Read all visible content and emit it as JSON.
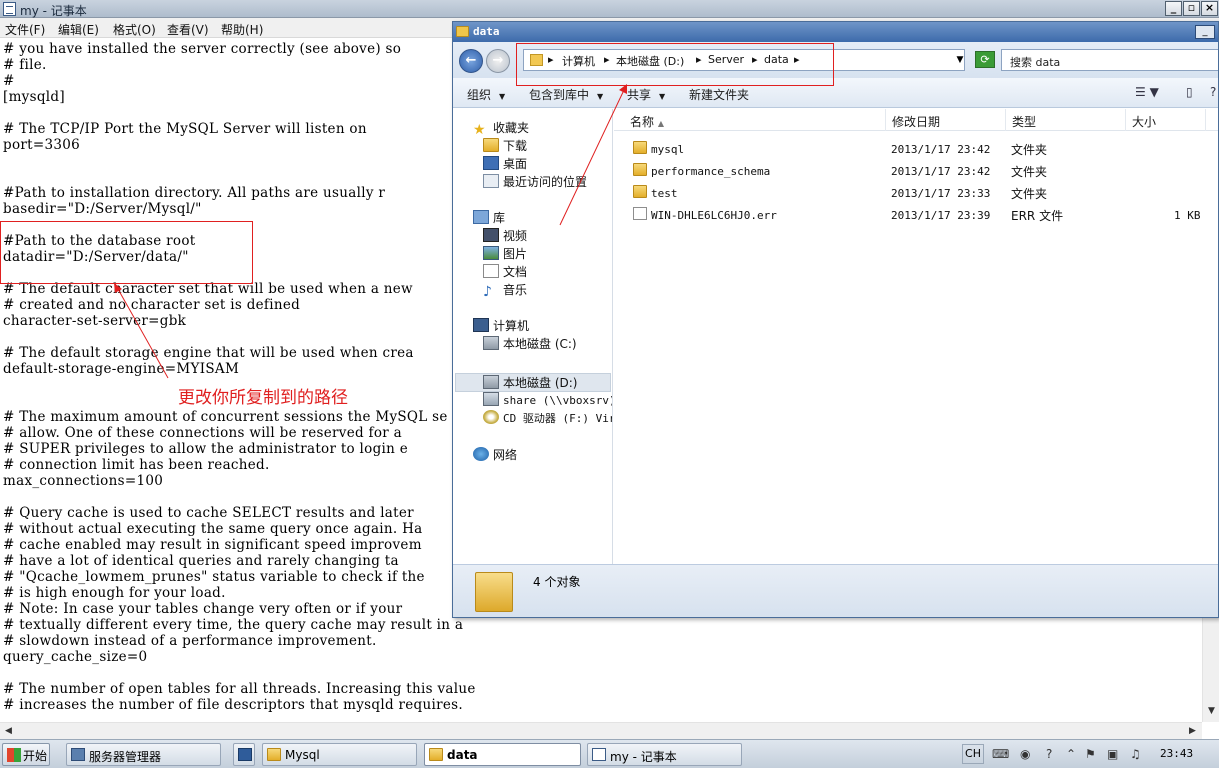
{
  "notepad": {
    "title": "my - 记事本",
    "menu": [
      "文件(F)",
      "编辑(E)",
      "格式(O)",
      "查看(V)",
      "帮助(H)"
    ],
    "lines": [
      "# you have installed the server correctly (see above) so",
      "# file.",
      "#",
      "[mysqld]",
      "",
      "# The TCP/IP Port the MySQL Server will listen on",
      "port=3306",
      "",
      "",
      "#Path to installation directory. All paths are usually r",
      "basedir=\"D:/Server/Mysql/\"",
      "",
      "#Path to the database root",
      "datadir=\"D:/Server/data/\"",
      "",
      "# The default character set that will be used when a new",
      "# created and no character set is defined",
      "character-set-server=gbk",
      "",
      "# The default storage engine that will be used when crea",
      "default-storage-engine=MYISAM",
      "",
      "",
      "# The maximum amount of concurrent sessions the MySQL se",
      "# allow. One of these connections will be reserved for a",
      "# SUPER privileges to allow the administrator to login e",
      "# connection limit has been reached.",
      "max_connections=100",
      "",
      "# Query cache is used to cache SELECT results and later ",
      "# without actual executing the same query once again. Ha",
      "# cache enabled may result in significant speed improvem",
      "# have a lot of identical queries and rarely changing ta",
      "# \"Qcache_lowmem_prunes\" status variable to check if the",
      "# is high enough for your load.",
      "# Note: In case your tables change very often or if your",
      "# textually different every time, the query cache may result in a",
      "# slowdown instead of a performance improvement.",
      "query_cache_size=0",
      "",
      "# The number of open tables for all threads. Increasing this value",
      "# increases the number of file descriptors that mysqld requires."
    ]
  },
  "explorer": {
    "title": "data",
    "breadcrumb": [
      "计算机",
      "本地磁盘 (D:)",
      "Server",
      "data"
    ],
    "search_placeholder": "搜索 data",
    "toolbar": {
      "organize": "组织",
      "include_in_library": "包含到库中",
      "share": "共享",
      "new_folder": "新建文件夹"
    },
    "nav": {
      "favorites": "收藏夹",
      "downloads": "下载",
      "desktop": "桌面",
      "recent": "最近访问的位置",
      "libraries": "库",
      "videos": "视频",
      "pictures": "图片",
      "documents": "文档",
      "music": "音乐",
      "computer": "计算机",
      "disk_c": "本地磁盘 (C:)",
      "disk_d": "本地磁盘 (D:)",
      "share": "share (\\\\vboxsrv)",
      "cd": "CD 驱动器 (F:) Vir",
      "network": "网络"
    },
    "columns": [
      "名称",
      "修改日期",
      "类型",
      "大小"
    ],
    "files": [
      {
        "name": "mysql",
        "date": "2013/1/17 23:42",
        "type": "文件夹",
        "size": ""
      },
      {
        "name": "performance_schema",
        "date": "2013/1/17 23:42",
        "type": "文件夹",
        "size": ""
      },
      {
        "name": "test",
        "date": "2013/1/17 23:33",
        "type": "文件夹",
        "size": ""
      },
      {
        "name": "WIN-DHLE6LC6HJ0.err",
        "date": "2013/1/17 23:39",
        "type": "ERR 文件",
        "size": "1 KB"
      }
    ],
    "status": "4 个对象"
  },
  "annotation": {
    "text": "更改你所复制到的路径",
    "color": "#e02020"
  },
  "taskbar": {
    "start": "开始",
    "tasks": [
      {
        "label": "服务器管理器",
        "active": false
      },
      {
        "label": "Mysql",
        "active": false
      },
      {
        "label": "data",
        "active": true
      },
      {
        "label": "my - 记事本",
        "active": false
      }
    ],
    "lang": "CH",
    "clock": "23:43"
  }
}
